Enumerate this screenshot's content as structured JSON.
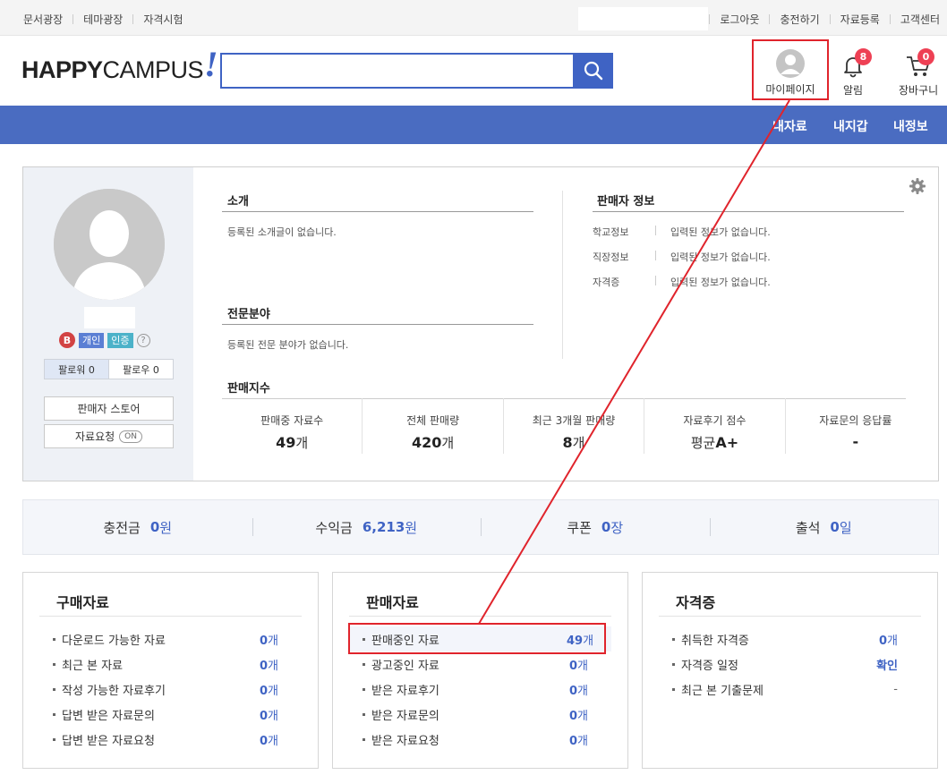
{
  "topbar": {
    "left": [
      "문서광장",
      "테마광장",
      "자격시험"
    ],
    "right": [
      "로그아웃",
      "충전하기",
      "자료등록",
      "고객센터"
    ]
  },
  "logo": {
    "bold": "HAPPY",
    "light": "CAMPUS",
    "mark": "!"
  },
  "search": {
    "value": "",
    "placeholder": ""
  },
  "header": {
    "mypage": "마이페이지",
    "alarm": {
      "label": "알림",
      "count": "8"
    },
    "cart": {
      "label": "장바구니",
      "count": "0"
    }
  },
  "nav": [
    "내자료",
    "내지갑",
    "내정보"
  ],
  "profile": {
    "grade": "B",
    "tag_personal": "개인",
    "tag_verified": "인증",
    "help": "?",
    "followers": "팔로워 0",
    "following": "팔로우 0",
    "store_button": "판매자 스토어",
    "request_button": "자료요청",
    "request_toggle": "ON",
    "intro": {
      "title": "소개",
      "text": "등록된 소개글이 없습니다."
    },
    "specialty": {
      "title": "전문분야",
      "text": "등록된 전문 분야가 없습니다."
    },
    "seller": {
      "title": "판매자 정보",
      "rows": [
        {
          "key": "학교정보",
          "value": "입력된 정보가 없습니다."
        },
        {
          "key": "직장정보",
          "value": "입력된 정보가 없습니다."
        },
        {
          "key": "자격증",
          "value": "입력된 정보가 없습니다."
        }
      ]
    },
    "stats_title": "판매지수",
    "stats": [
      {
        "label": "판매중 자료수",
        "value": "49",
        "unit": "개"
      },
      {
        "label": "전체 판매량",
        "value": "420",
        "unit": "개"
      },
      {
        "label": "최근 3개월 판매량",
        "value": "8",
        "unit": "개"
      },
      {
        "label": "자료후기 점수",
        "prefix": "평균",
        "value": "A+",
        "unit": ""
      },
      {
        "label": "자료문의 응답률",
        "value": "-",
        "unit": ""
      }
    ]
  },
  "balance": [
    {
      "label": "충전금",
      "value": "0",
      "unit": "원"
    },
    {
      "label": "수익금",
      "value": "6,213",
      "unit": "원"
    },
    {
      "label": "쿠폰",
      "value": "0",
      "unit": "장"
    },
    {
      "label": "출석",
      "value": "0",
      "unit": "일"
    }
  ],
  "boxes": {
    "purchase": {
      "title": "구매자료",
      "rows": [
        {
          "label": "다운로드 가능한 자료",
          "value": "0",
          "unit": "개"
        },
        {
          "label": "최근 본 자료",
          "value": "0",
          "unit": "개"
        },
        {
          "label": "작성 가능한 자료후기",
          "value": "0",
          "unit": "개"
        },
        {
          "label": "답변 받은 자료문의",
          "value": "0",
          "unit": "개"
        },
        {
          "label": "답변 받은 자료요청",
          "value": "0",
          "unit": "개"
        }
      ]
    },
    "sales": {
      "title": "판매자료",
      "rows": [
        {
          "label": "판매중인 자료",
          "value": "49",
          "unit": "개"
        },
        {
          "label": "광고중인 자료",
          "value": "0",
          "unit": "개"
        },
        {
          "label": "받은 자료후기",
          "value": "0",
          "unit": "개"
        },
        {
          "label": "받은 자료문의",
          "value": "0",
          "unit": "개"
        },
        {
          "label": "받은 자료요청",
          "value": "0",
          "unit": "개"
        }
      ]
    },
    "cert": {
      "title": "자격증",
      "rows": [
        {
          "label": "취득한 자격증",
          "value": "0",
          "unit": "개"
        },
        {
          "label": "자격증 일정",
          "link": "확인"
        },
        {
          "label": "최근 본 기출문제",
          "plain": "-"
        }
      ]
    }
  },
  "colors": {
    "brand": "#3f63c4",
    "nav": "#4a6cc1",
    "highlight": "#e0242c",
    "badge": "#ee4054"
  }
}
